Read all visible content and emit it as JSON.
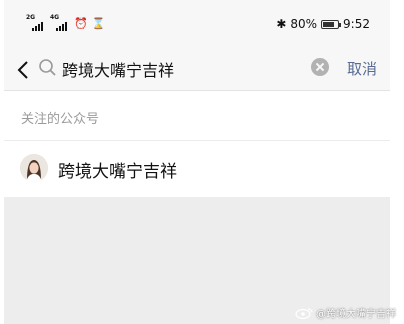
{
  "status_bar": {
    "net1_label": "2G",
    "net2_label": "4G",
    "alarm_icon": "alarm-clock-icon",
    "hourglass_icon": "hourglass-icon",
    "bluetooth_icon": "bluetooth-icon",
    "battery_percent": "80%",
    "battery_level": 0.8,
    "time": "9:52"
  },
  "search": {
    "query": "跨境大嘴宁吉祥",
    "cancel_label": "取消"
  },
  "section": {
    "title": "关注的公众号"
  },
  "results": [
    {
      "name": "跨境大嘴宁吉祥"
    }
  ],
  "watermark": {
    "text": "@跨境大嘴宁吉祥",
    "icon": "weibo-icon"
  },
  "colors": {
    "accent": "#576b95",
    "background": "#ededed",
    "bar": "#f7f7f7"
  }
}
